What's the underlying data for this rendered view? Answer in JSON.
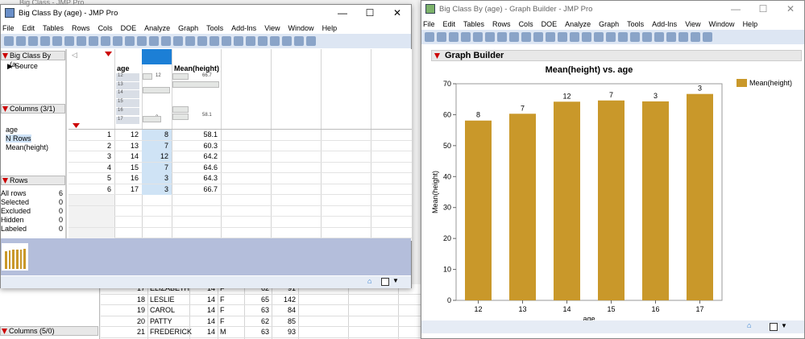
{
  "bg_window": {
    "title": "Big Class - JMP Pro",
    "columns_panel": "Columns (5/0)",
    "rows": [
      [
        "17",
        "ELIZABETH",
        "14",
        "F",
        "62",
        "91"
      ],
      [
        "18",
        "LESLIE",
        "14",
        "F",
        "65",
        "142"
      ],
      [
        "19",
        "CAROL",
        "14",
        "F",
        "63",
        "84"
      ],
      [
        "20",
        "PATTY",
        "14",
        "F",
        "62",
        "85"
      ],
      [
        "21",
        "FREDERICK",
        "14",
        "M",
        "63",
        "93"
      ]
    ]
  },
  "left_window": {
    "title": "Big Class By (age) - JMP Pro",
    "menu": [
      "File",
      "Edit",
      "Tables",
      "Rows",
      "Cols",
      "DOE",
      "Analyze",
      "Graph",
      "Tools",
      "Add-Ins",
      "View",
      "Window",
      "Help"
    ],
    "table_panel": "Big Class By (a...",
    "source": "Source",
    "columns_panel": "Columns (3/1)",
    "columns": [
      "age",
      "N Rows",
      "Mean(height)"
    ],
    "rows_panel": "Rows",
    "row_states": [
      {
        "label": "All rows",
        "value": "6"
      },
      {
        "label": "Selected",
        "value": "0"
      },
      {
        "label": "Excluded",
        "value": "0"
      },
      {
        "label": "Hidden",
        "value": "0"
      },
      {
        "label": "Labeled",
        "value": "0"
      }
    ],
    "headers": [
      "age",
      "N Rows",
      "Mean(height)"
    ],
    "summary": {
      "age_levels": [
        "12",
        "13",
        "14",
        "15",
        "16",
        "17"
      ],
      "nrows_max": "12",
      "nrows_min": "3",
      "mean_max": "66.7",
      "mean_min": "58.1"
    },
    "rows": [
      [
        "1",
        "12",
        "8",
        "58.1"
      ],
      [
        "2",
        "13",
        "7",
        "60.3"
      ],
      [
        "3",
        "14",
        "12",
        "64.2"
      ],
      [
        "4",
        "15",
        "7",
        "64.6"
      ],
      [
        "5",
        "16",
        "3",
        "64.3"
      ],
      [
        "6",
        "17",
        "3",
        "66.7"
      ]
    ]
  },
  "right_window": {
    "title": "Big Class By (age) - Graph Builder - JMP Pro",
    "menu": [
      "File",
      "Edit",
      "Tables",
      "Rows",
      "Cols",
      "DOE",
      "Analyze",
      "Graph",
      "Tools",
      "Add-Ins",
      "View",
      "Window",
      "Help"
    ],
    "section": "Graph Builder"
  },
  "chart_data": {
    "type": "bar",
    "title": "Mean(height) vs. age",
    "xlabel": "age",
    "ylabel": "Mean(height)",
    "categories": [
      "12",
      "13",
      "14",
      "15",
      "16",
      "17"
    ],
    "series": [
      {
        "name": "Mean(height)",
        "values": [
          58.1,
          60.3,
          64.2,
          64.6,
          64.3,
          66.7
        ],
        "labels": [
          "8",
          "7",
          "12",
          "7",
          "3",
          "3"
        ],
        "color": "#c9982a"
      }
    ],
    "ylim": [
      0,
      70
    ],
    "yticks": [
      0,
      10,
      20,
      30,
      40,
      50,
      60,
      70
    ],
    "legend": "right",
    "grid": false
  }
}
